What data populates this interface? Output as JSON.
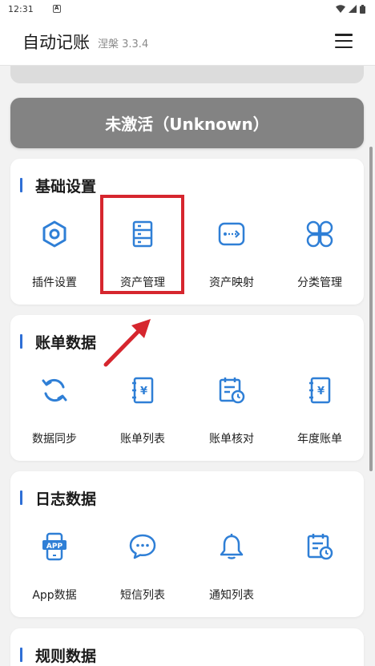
{
  "status_bar": {
    "time": "12:31",
    "notification_icon": "a-badge-icon",
    "icons": [
      "wifi-icon",
      "signal-icon",
      "battery-icon"
    ]
  },
  "app_bar": {
    "title": "自动记账",
    "subtitle": "涅槃 3.3.4",
    "menu_icon": "hamburger-menu-icon"
  },
  "activation": {
    "label": "未激活（Unknown）"
  },
  "sections": [
    {
      "title": "基础设置",
      "items": [
        {
          "label": "插件设置",
          "icon": "hexagon-plugin-icon"
        },
        {
          "label": "资产管理",
          "icon": "server-stack-icon"
        },
        {
          "label": "资产映射",
          "icon": "mapping-arrow-icon"
        },
        {
          "label": "分类管理",
          "icon": "clover-category-icon"
        }
      ]
    },
    {
      "title": "账单数据",
      "items": [
        {
          "label": "数据同步",
          "icon": "sync-icon"
        },
        {
          "label": "账单列表",
          "icon": "ledger-icon"
        },
        {
          "label": "账单核对",
          "icon": "calendar-clock-icon"
        },
        {
          "label": "年度账单",
          "icon": "ledger-icon"
        }
      ]
    },
    {
      "title": "日志数据",
      "items": [
        {
          "label": "App数据",
          "icon": "app-phone-icon"
        },
        {
          "label": "短信列表",
          "icon": "chat-bubble-icon"
        },
        {
          "label": "通知列表",
          "icon": "bell-icon"
        },
        {
          "label": "",
          "icon": "calendar-clock-icon"
        }
      ]
    },
    {
      "title": "规则数据"
    }
  ],
  "colors": {
    "icon_blue": "#2f7fd6",
    "accent_bar": "#2f6fd6",
    "activation_bg": "#838383",
    "highlight_red": "#d6262e"
  }
}
